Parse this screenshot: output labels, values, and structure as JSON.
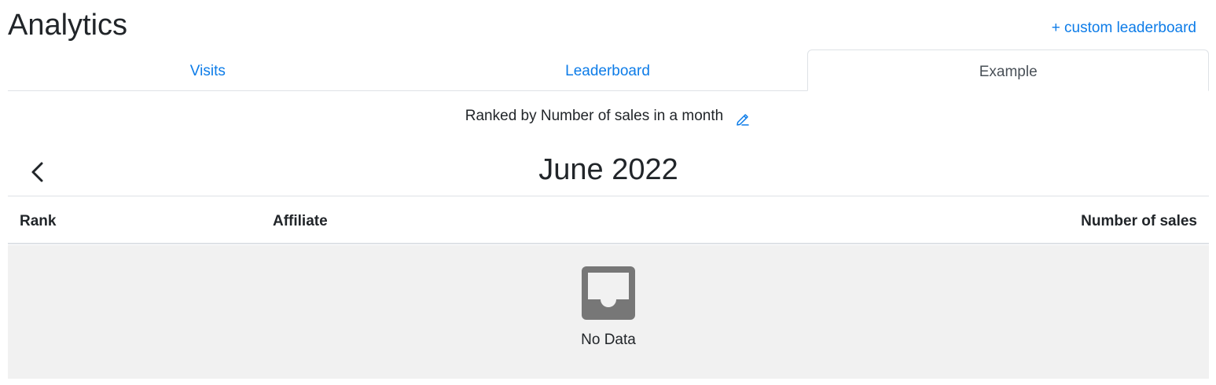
{
  "header": {
    "title": "Analytics",
    "custom_link": "+ custom leaderboard"
  },
  "tabs": [
    {
      "label": "Visits",
      "active": false
    },
    {
      "label": "Leaderboard",
      "active": false
    },
    {
      "label": "Example",
      "active": true
    }
  ],
  "ranking": {
    "label": "Ranked by Number of sales in a month",
    "edit_icon": "pencil-icon"
  },
  "period": {
    "title": "June 2022",
    "prev_icon": "chevron-left-icon"
  },
  "table": {
    "columns": [
      "Rank",
      "Affiliate",
      "Number of sales"
    ],
    "rows": [],
    "empty_icon": "inbox-icon",
    "empty_text": "No Data"
  },
  "colors": {
    "link": "#0d7ce8",
    "text": "#212529",
    "active_tab_text": "#495057",
    "border": "#dee2e6",
    "empty_bg": "#f1f1f1",
    "empty_icon": "#777777"
  }
}
